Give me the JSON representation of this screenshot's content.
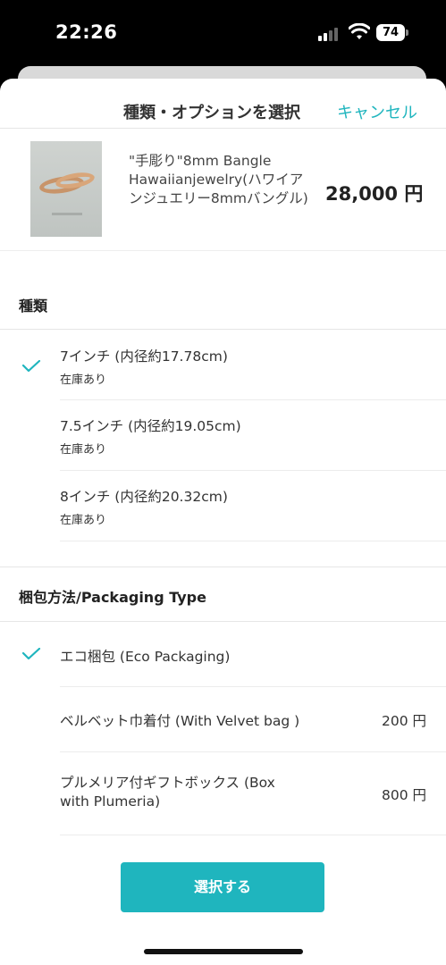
{
  "status_bar": {
    "time": "22:26",
    "battery": "74"
  },
  "header": {
    "title": "種類・オプションを選択",
    "cancel_label": "キャンセル"
  },
  "product": {
    "name": "\"手彫り\"8mm Bangle Hawaiianjewelry(ハワイアンジュエリー8mmバングル)",
    "price": "28,000 円"
  },
  "type_section": {
    "title": "種類",
    "options": [
      {
        "label": "7インチ (内径約17.78cm)",
        "stock": "在庫あり",
        "selected": true
      },
      {
        "label": "7.5インチ (内径約19.05cm)",
        "stock": "在庫あり",
        "selected": false
      },
      {
        "label": "8インチ (内径約20.32cm)",
        "stock": "在庫あり",
        "selected": false
      }
    ]
  },
  "packaging_section": {
    "title": "梱包方法/Packaging Type",
    "options": [
      {
        "label": "エコ梱包 (Eco Packaging)",
        "price": "",
        "selected": true
      },
      {
        "label": "ベルベット巾着付 (With Velvet bag )",
        "price": "200 円",
        "selected": false
      },
      {
        "label": "プルメリア付ギフトボックス (Box with Plumeria)",
        "price": "800 円",
        "selected": false
      }
    ]
  },
  "footer": {
    "select_label": "選択する"
  },
  "colors": {
    "accent": "#1fb5be",
    "text": "#333333",
    "divider": "#e6e6e6"
  },
  "icons": [
    "cellular-signal-icon",
    "wifi-icon",
    "battery-icon",
    "checkmark-icon"
  ]
}
